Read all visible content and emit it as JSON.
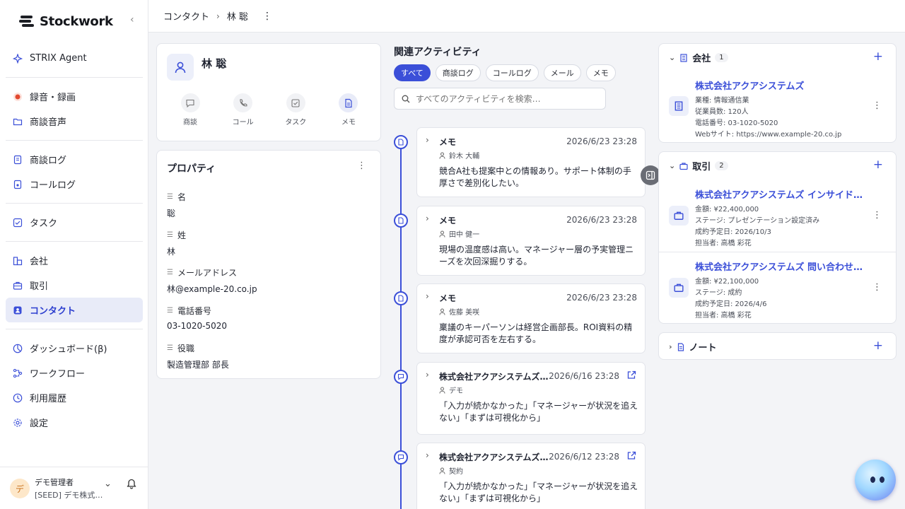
{
  "app": {
    "name": "Stockwork"
  },
  "sidebar": {
    "groups": [
      [
        {
          "label": "STRIX Agent",
          "icon": "sparkle-icon"
        }
      ],
      [
        {
          "label": "録音・録画",
          "icon": "record-icon"
        },
        {
          "label": "商談音声",
          "icon": "folder-icon"
        }
      ],
      [
        {
          "label": "商談ログ",
          "icon": "document-icon"
        },
        {
          "label": "コールログ",
          "icon": "phone-log-icon"
        }
      ],
      [
        {
          "label": "タスク",
          "icon": "checkbox-icon"
        }
      ],
      [
        {
          "label": "会社",
          "icon": "building-icon"
        },
        {
          "label": "取引",
          "icon": "briefcase-icon"
        },
        {
          "label": "コンタクト",
          "icon": "contact-icon",
          "active": true
        }
      ],
      [
        {
          "label": "ダッシュボード(β)",
          "icon": "dashboard-icon"
        },
        {
          "label": "ワークフロー",
          "icon": "workflow-icon"
        },
        {
          "label": "利用履歴",
          "icon": "clock-icon"
        },
        {
          "label": "設定",
          "icon": "gear-icon"
        }
      ]
    ]
  },
  "user": {
    "avatar": "デ",
    "name": "デモ管理者",
    "org": "[SEED] デモ株式…"
  },
  "breadcrumb": {
    "root": "コンタクト",
    "current": "林 聡"
  },
  "contact": {
    "name": "林 聡",
    "actions": [
      {
        "label": "商談",
        "icon": "chat-icon"
      },
      {
        "label": "コール",
        "icon": "phone-icon"
      },
      {
        "label": "タスク",
        "icon": "task-icon"
      },
      {
        "label": "メモ",
        "icon": "memo-icon"
      }
    ]
  },
  "properties": {
    "title": "プロパティ",
    "items": [
      {
        "label": "名",
        "value": "聡"
      },
      {
        "label": "姓",
        "value": "林"
      },
      {
        "label": "メールアドレス",
        "value": "林@example-20.co.jp"
      },
      {
        "label": "電話番号",
        "value": "03-1020-5020"
      },
      {
        "label": "役職",
        "value": "製造管理部 部長"
      }
    ]
  },
  "activities": {
    "title": "関連アクティビティ",
    "filters": [
      "すべて",
      "商談ログ",
      "コールログ",
      "メール",
      "メモ"
    ],
    "search_placeholder": "すべてのアクティビティを検索…",
    "items": [
      {
        "type": "メモ",
        "date": "2026/6/23 23:28",
        "user": "鈴木 大輔",
        "body": "競合A社も提案中との情報あり。サポート体制の手厚さで差別化したい。",
        "kind": "memo"
      },
      {
        "type": "メモ",
        "date": "2026/6/23 23:28",
        "user": "田中 健一",
        "body": "現場の温度感は高い。マネージャー層の予実管理ニーズを次回深掘りする。",
        "kind": "memo"
      },
      {
        "type": "メモ",
        "date": "2026/6/23 23:28",
        "user": "佐藤 美咲",
        "body": "稟議のキーパーソンは経営企画部長。ROI資料の精度が承認可否を左右する。",
        "kind": "memo"
      },
      {
        "type": "株式会社アクアシステムズ…",
        "date": "2026/6/16 23:28",
        "user": "デモ",
        "body": "「入力が続かなかった」「マネージャーが状況を追えない」「まずは可視化から」",
        "kind": "meeting"
      },
      {
        "type": "株式会社アクアシステムズ…",
        "date": "2026/6/12 23:28",
        "user": "契約",
        "body": "「入力が続かなかった」「マネージャーが状況を追えない」「まずは可視化から」",
        "kind": "meeting"
      }
    ]
  },
  "company": {
    "title": "会社",
    "count": "1",
    "item": {
      "name": "株式会社アクアシステムズ",
      "lines": [
        "業種: 情報通信業",
        "従業員数: 120人",
        "電話番号: 03-1020-5020",
        "Webサイト: https://www.example-20.co.jp"
      ]
    }
  },
  "deals": {
    "title": "取引",
    "count": "2",
    "items": [
      {
        "name": "株式会社アクアシステムズ インサイドセ…",
        "lines": [
          "金額: ¥22,400,000",
          "ステージ: プレゼンテーション設定済み",
          "成約予定日: 2026/10/3",
          "担当者: 高橋 彩花"
        ]
      },
      {
        "name": "株式会社アクアシステムズ 問い合わせ管…",
        "lines": [
          "金額: ¥22,100,000",
          "ステージ: 成約",
          "成約予定日: 2026/4/6",
          "担当者: 高橋 彩花"
        ]
      }
    ]
  },
  "notes": {
    "title": "ノート"
  },
  "colors": {
    "accent": "#3b4fd8",
    "active_bg": "#e8ebf8"
  }
}
